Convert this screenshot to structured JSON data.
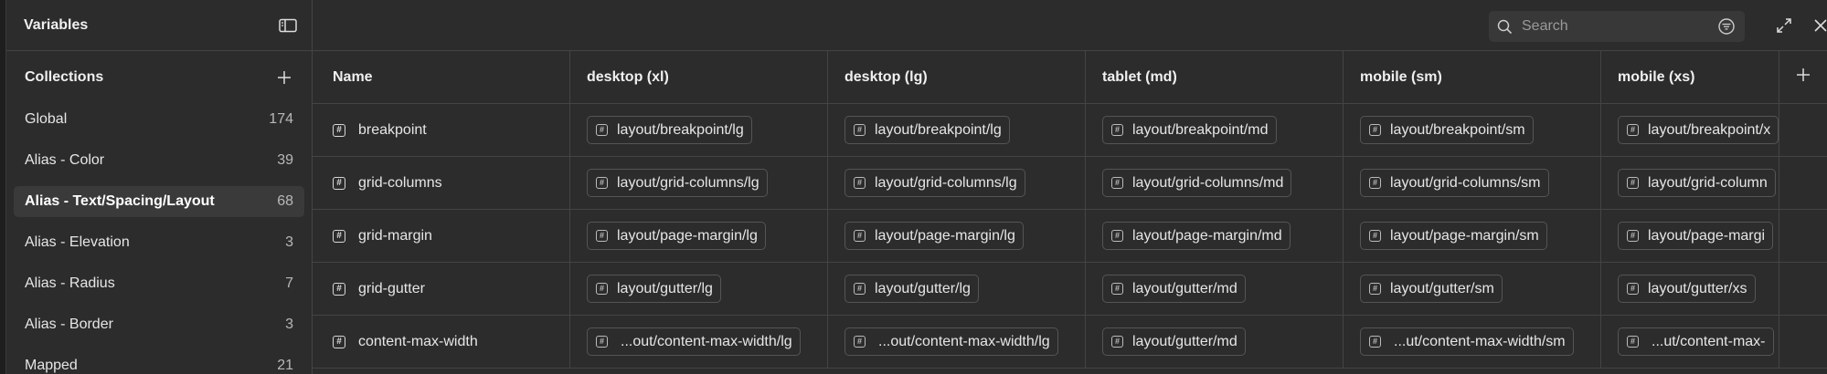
{
  "sidebar": {
    "title": "Variables",
    "collections_title": "Collections",
    "items": [
      {
        "label": "Global",
        "count": "174"
      },
      {
        "label": "Alias - Color",
        "count": "39"
      },
      {
        "label": "Alias - Text/Spacing/Layout",
        "count": "68"
      },
      {
        "label": "Alias - Elevation",
        "count": "3"
      },
      {
        "label": "Alias - Radius",
        "count": "7"
      },
      {
        "label": "Alias - Border",
        "count": "3"
      },
      {
        "label": "Mapped",
        "count": "21"
      }
    ],
    "selected_index": 2
  },
  "toolbar": {
    "search_placeholder": "Search"
  },
  "table": {
    "columns": [
      "Name",
      "desktop (xl)",
      "desktop (lg)",
      "tablet (md)",
      "mobile (sm)",
      "mobile (xs)"
    ],
    "rows": [
      {
        "name": "breakpoint",
        "values": [
          "layout/breakpoint/lg",
          "layout/breakpoint/lg",
          "layout/breakpoint/md",
          "layout/breakpoint/sm",
          "layout/breakpoint/x"
        ]
      },
      {
        "name": "grid-columns",
        "values": [
          "layout/grid-columns/lg",
          "layout/grid-columns/lg",
          "layout/grid-columns/md",
          "layout/grid-columns/sm",
          "layout/grid-column"
        ]
      },
      {
        "name": "grid-margin",
        "values": [
          "layout/page-margin/lg",
          "layout/page-margin/lg",
          "layout/page-margin/md",
          "layout/page-margin/sm",
          "layout/page-margi"
        ]
      },
      {
        "name": "grid-gutter",
        "values": [
          "layout/gutter/lg",
          "layout/gutter/lg",
          "layout/gutter/md",
          "layout/gutter/sm",
          "layout/gutter/xs"
        ]
      },
      {
        "name": "content-max-width",
        "values": [
          "...out/content-max-width/lg",
          "...out/content-max-width/lg",
          "layout/gutter/md",
          "...ut/content-max-width/sm",
          "...ut/content-max-"
        ]
      }
    ]
  },
  "colors": {
    "background": "#2c2c2c",
    "border": "#444444",
    "selected": "#3a3a3a",
    "text": "#e6e6e6"
  }
}
